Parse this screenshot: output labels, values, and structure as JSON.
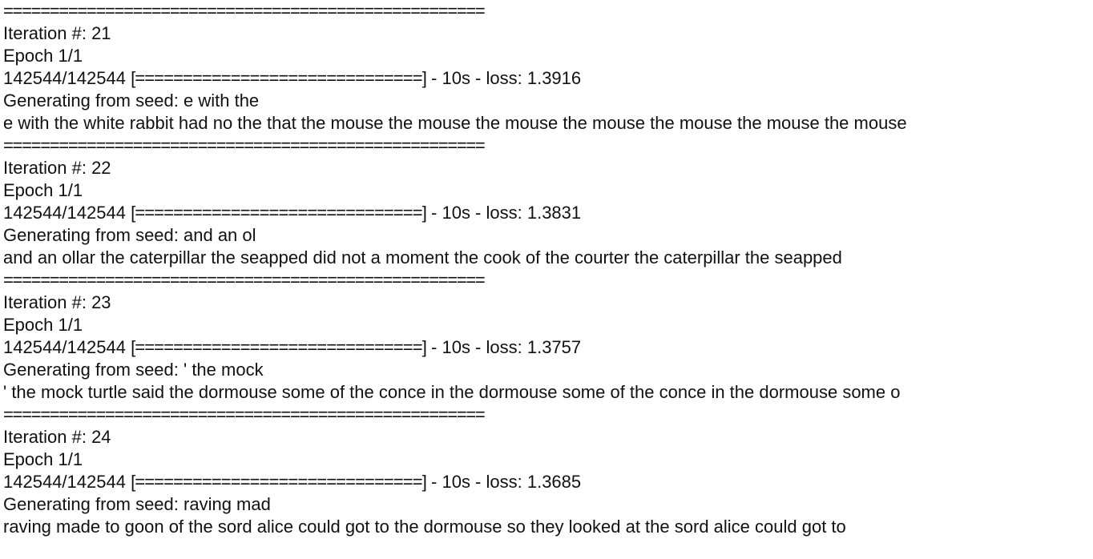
{
  "blocks": [
    {
      "separator": "====================================================",
      "iteration": "Iteration #: 21",
      "epoch": "Epoch 1/1",
      "progress_count": "142544/142544",
      "progress_bar": "[==============================]",
      "progress_tail": " - 10s - loss: 1.3916",
      "seed": "Generating from seed: e with the",
      "output": "e with the white rabbit had no the that the mouse the mouse the mouse the mouse the mouse the mouse the mouse"
    },
    {
      "separator": "====================================================",
      "iteration": "Iteration #: 22",
      "epoch": "Epoch 1/1",
      "progress_count": "142544/142544",
      "progress_bar": "[==============================]",
      "progress_tail": " - 10s - loss: 1.3831",
      "seed": "Generating from seed: and an ol",
      "output": "and an ollar the caterpillar the seapped did not a moment the cook of the courter the caterpillar the seapped"
    },
    {
      "separator": "====================================================",
      "iteration": "Iteration #: 23",
      "epoch": "Epoch 1/1",
      "progress_count": "142544/142544",
      "progress_bar": "[==============================]",
      "progress_tail": " - 10s - loss: 1.3757",
      "seed": "Generating from seed: ' the mock",
      "output": "' the mock turtle said the dormouse some of the conce in the dormouse some of the conce in the dormouse some o"
    },
    {
      "separator": "====================================================",
      "iteration": "Iteration #: 24",
      "epoch": "Epoch 1/1",
      "progress_count": "142544/142544",
      "progress_bar": "[==============================]",
      "progress_tail": " - 10s - loss: 1.3685",
      "seed": "Generating from seed: raving mad",
      "output": "raving made to goon of the sord alice could got to the dormouse so they looked at the sord alice could got to"
    }
  ]
}
